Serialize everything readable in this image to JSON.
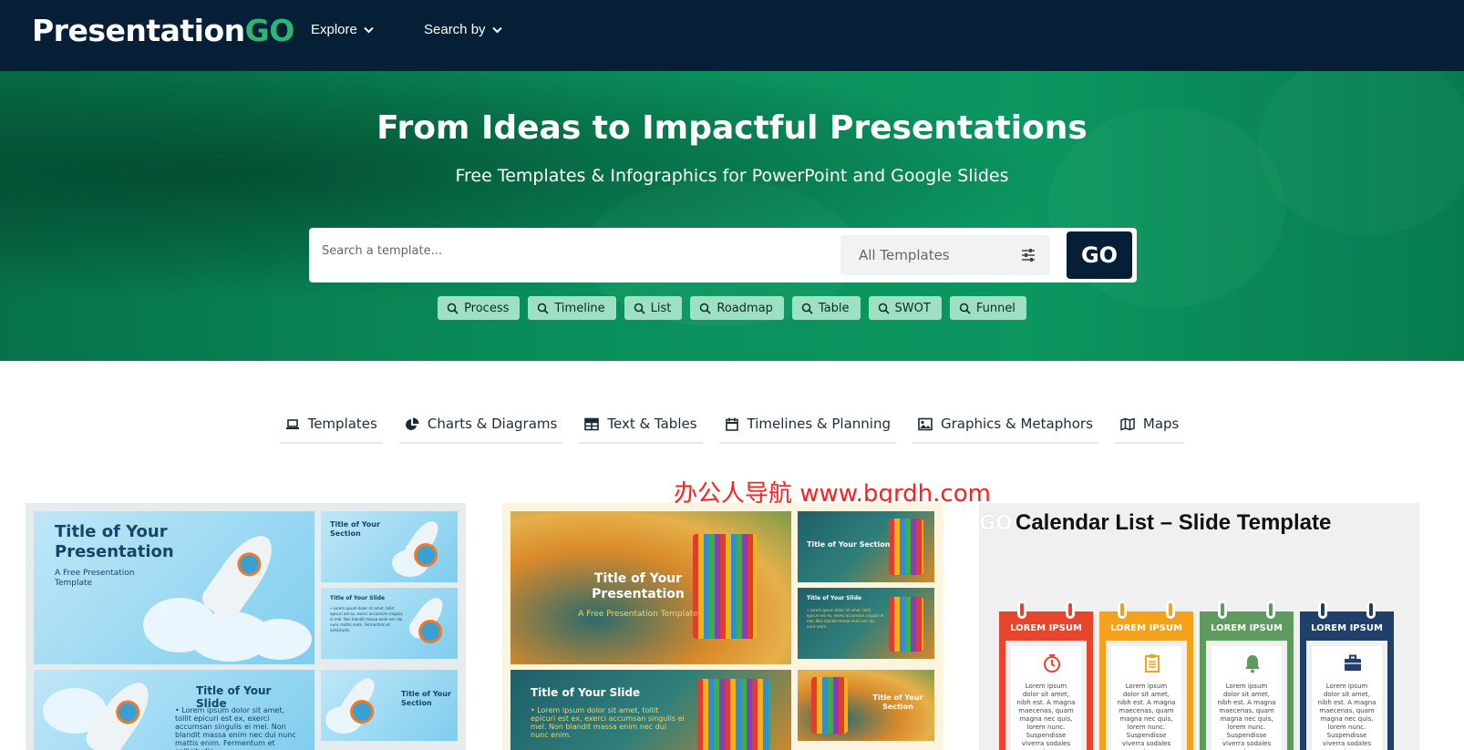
{
  "nav": {
    "logo_main": "Presentation",
    "logo_accent": "GO",
    "explore_label": "Explore",
    "searchby_label": "Search by"
  },
  "hero": {
    "title": "From Ideas to Impactful Presentations",
    "subtitle": "Free Templates & Infographics for PowerPoint and Google Slides",
    "search_placeholder": "Search a template...",
    "select_value": "All Templates",
    "go_label": "GO",
    "tags": [
      "Process",
      "Timeline",
      "List",
      "Roadmap",
      "Table",
      "SWOT",
      "Funnel"
    ]
  },
  "categories": [
    {
      "label": "Templates",
      "icon": "laptop-icon"
    },
    {
      "label": "Charts & Diagrams",
      "icon": "pie-chart-icon"
    },
    {
      "label": "Text & Tables",
      "icon": "table-icon"
    },
    {
      "label": "Timelines & Planning",
      "icon": "calendar-icon"
    },
    {
      "label": "Graphics & Metaphors",
      "icon": "image-icon"
    },
    {
      "label": "Maps",
      "icon": "map-icon"
    }
  ],
  "watermark": "办公人导航  www.bgrdh.com",
  "cards": {
    "rocket": {
      "main_title": "Title of Your Presentation",
      "main_sub": "A Free Presentation Template",
      "section_title": "Title of Your Section",
      "slide_title": "Title of Your Slide",
      "slide_bullet": "• Lorem ipsum dolor sit amet, tollit epicuri est ex, exerci accumsan singulis ei mel. Non blandit massa enim nec dui nunc mattis enim. Fermentum et sollicitudin"
    },
    "autumn": {
      "main_title": "Title of Your Presentation",
      "main_sub": "A Free Presentation Template",
      "section_title": "Title of Your Section",
      "slide_title": "Title of Your Slide",
      "slide_bullet": "• Lorem ipsum dolor sit amet, tollit epicuri est ex, exerci accumsan singulis ei mel. Non blandit massa enim nec dui nunc enim."
    },
    "calendar": {
      "logo_fragment": "GO",
      "title": "Calendar List – Slide Template",
      "columns": [
        {
          "label": "LOREM IPSUM",
          "color": "#e8452f",
          "icon": "clock-icon"
        },
        {
          "label": "LOREM IPSUM",
          "color": "#f4a21b",
          "icon": "clipboard-icon"
        },
        {
          "label": "LOREM IPSUM",
          "color": "#5f9a5e",
          "icon": "bell-icon"
        },
        {
          "label": "LOREM IPSUM",
          "color": "#213f6b",
          "icon": "briefcase-icon"
        }
      ],
      "body_text": "Lorem ipsum dolor sit amet, nibh est. A magna maecenas, quam magna nec quis, lorem nunc. Suspendisse viverra sodales mauris, cras pharetra proin egestas arcu erat dolor, at."
    }
  },
  "colors": {
    "nav_bg": "#041f36",
    "accent_green": "#2bb673",
    "hero_green": "#0a8f5c",
    "tag_bg": "#9ee0c4"
  }
}
